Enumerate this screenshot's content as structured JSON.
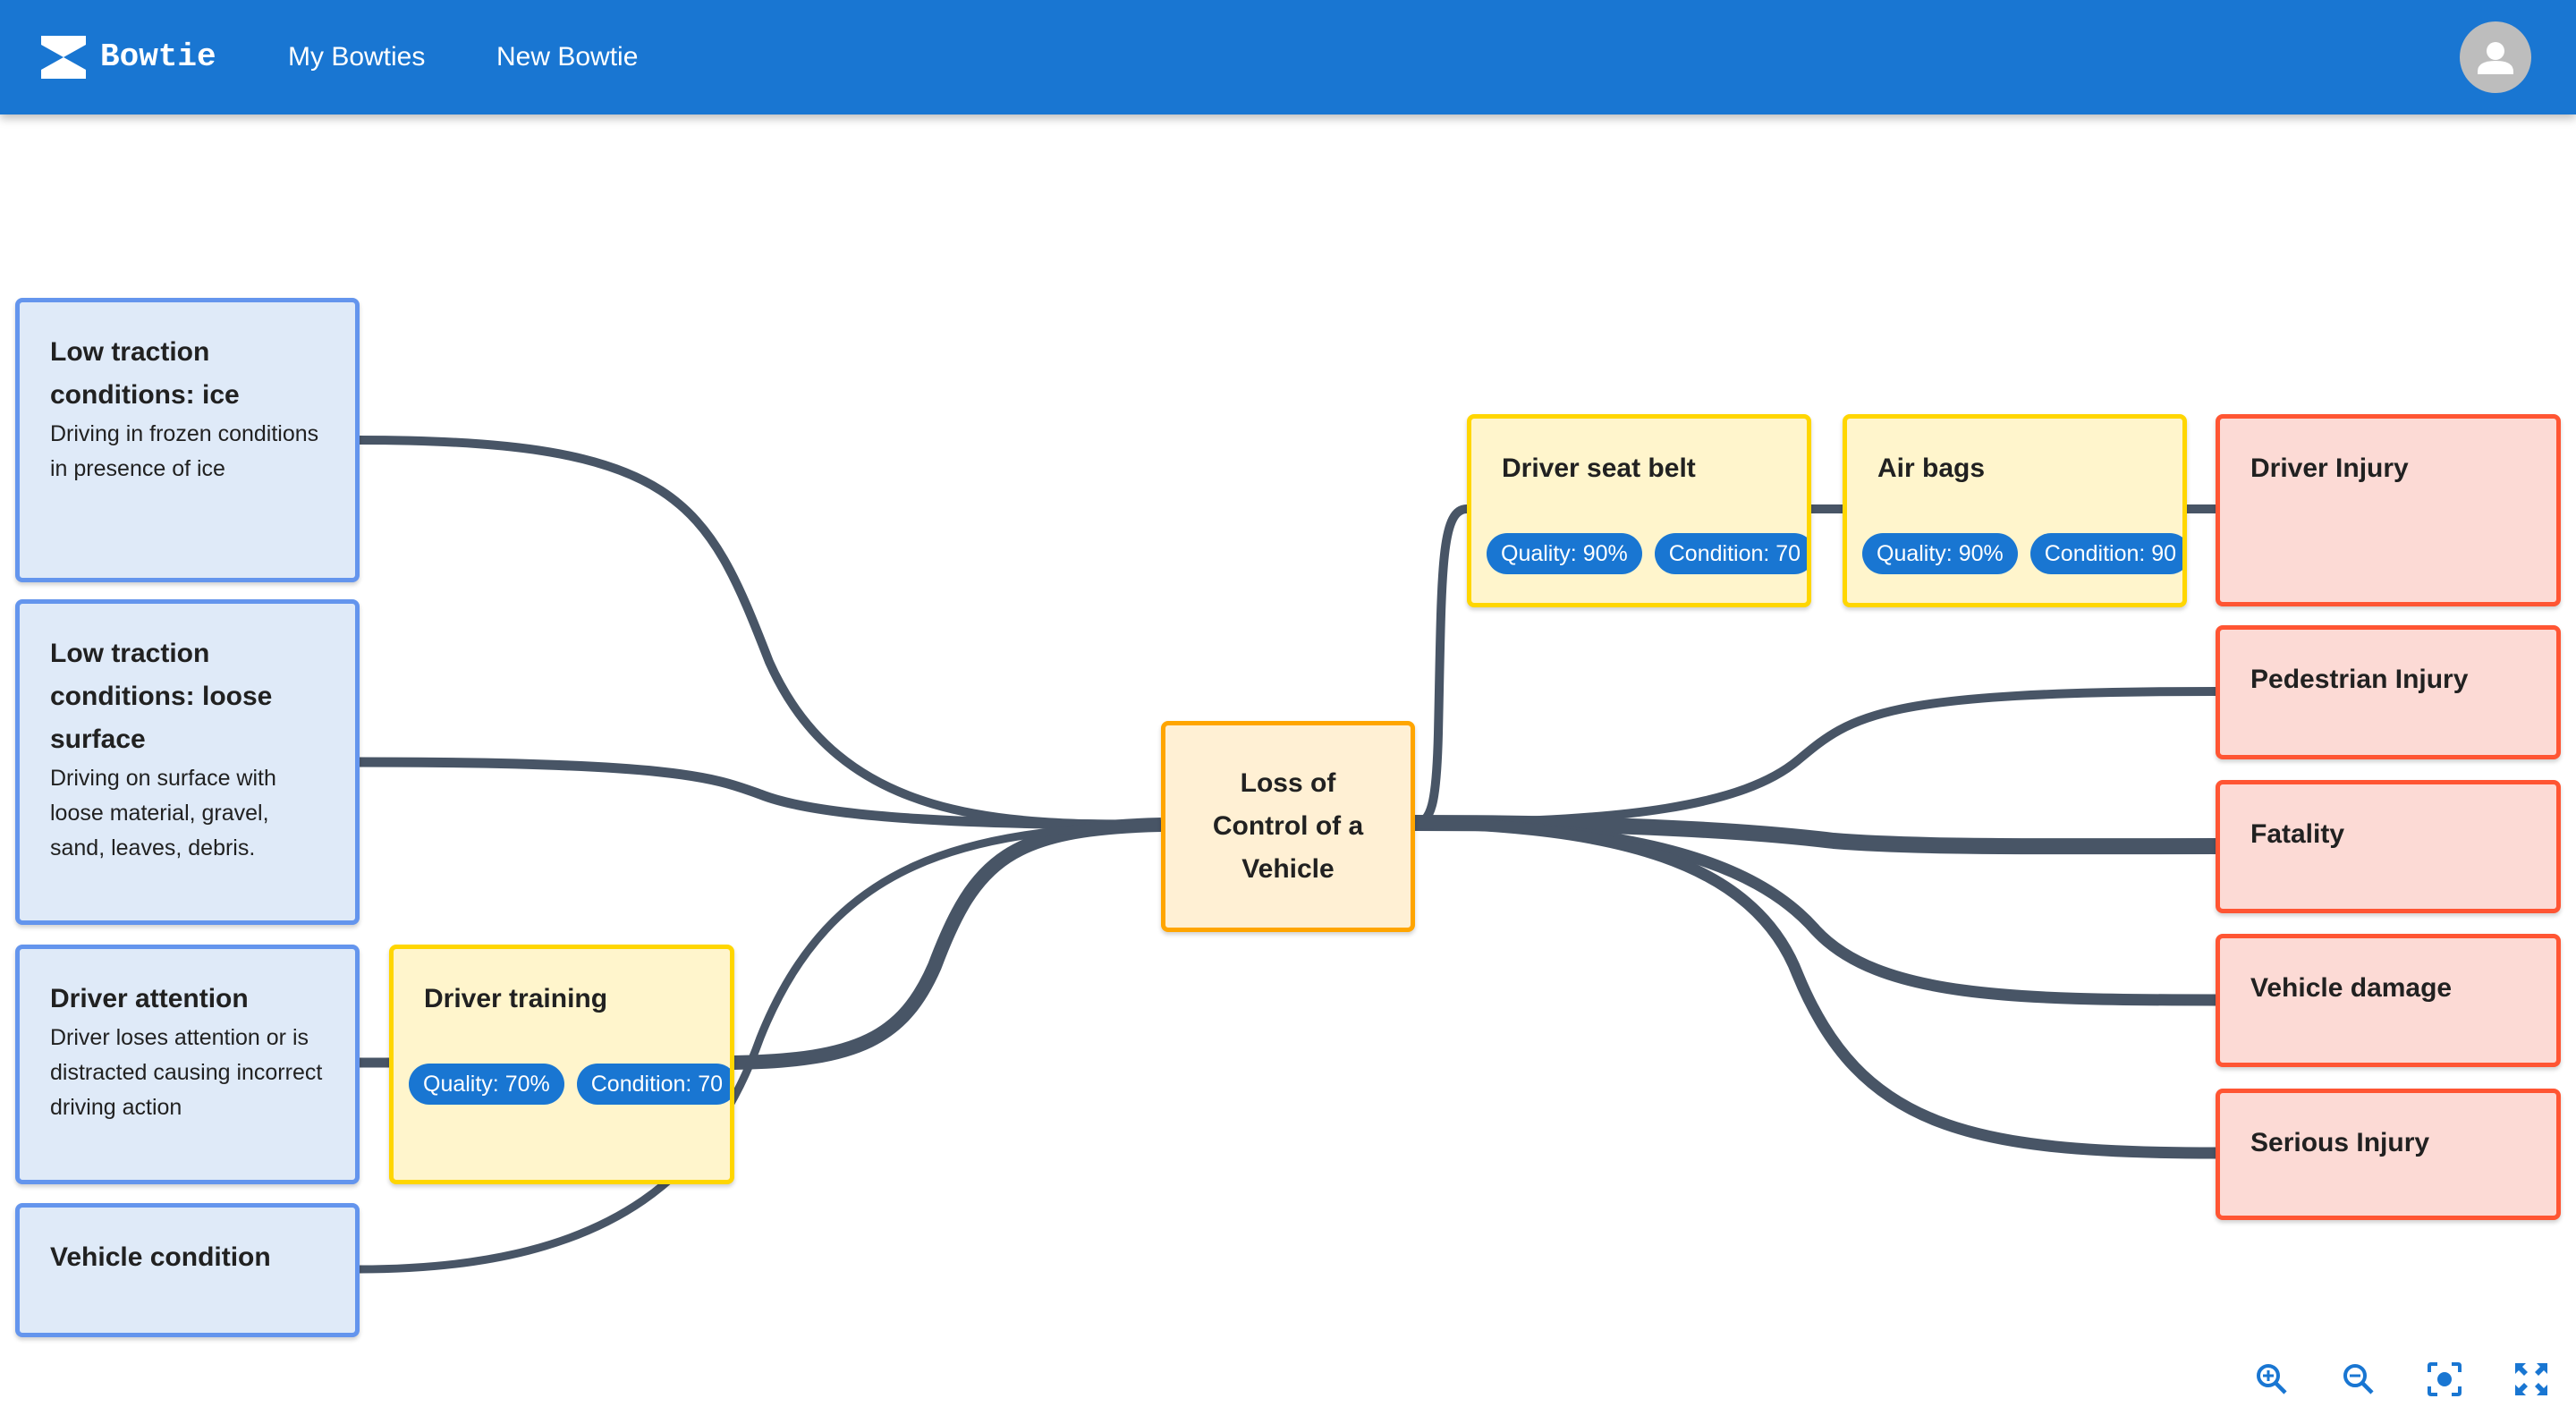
{
  "appbar": {
    "brand": "Bowtie",
    "nav": [
      "My Bowties",
      "New Bowtie"
    ],
    "logo_icon": "bowtie-logo-icon",
    "avatar_icon": "account-icon",
    "color": "#1976d2"
  },
  "diagram": {
    "causes": [
      {
        "title": "Low traction conditions: ice",
        "description": "Driving in frozen conditions in presence of ice"
      },
      {
        "title": "Low traction conditions: loose surface",
        "description": "Driving on surface with loose material, gravel, sand, leaves, debris."
      },
      {
        "title": "Driver attention",
        "description": "Driver loses attention or is distracted causing incorrect driving action"
      },
      {
        "title": "Vehicle condition",
        "description": ""
      }
    ],
    "preventive_barriers": [
      {
        "title": "Driver training",
        "quality": "Quality: 70%",
        "condition": "Condition: 70",
        "cause": "Driver attention"
      }
    ],
    "top_event": {
      "title": "Loss of Control of a Vehicle"
    },
    "mitigating_barriers": [
      {
        "title": "Driver seat belt",
        "quality": "Quality: 90%",
        "condition": "Condition: 70",
        "consequence": "Driver Injury"
      },
      {
        "title": "Air bags",
        "quality": "Quality: 90%",
        "condition": "Condition: 90",
        "consequence": "Driver Injury"
      }
    ],
    "consequences": [
      {
        "title": "Driver Injury"
      },
      {
        "title": "Pedestrian Injury"
      },
      {
        "title": "Fatality"
      },
      {
        "title": "Vehicle damage"
      },
      {
        "title": "Serious Injury"
      }
    ],
    "colors": {
      "cause_fill": "#dfeaf8",
      "cause_border": "#6495ed",
      "barrier_fill": "#fff5cc",
      "barrier_border": "#ffd600",
      "event_fill": "#fff0d4",
      "event_border": "#ffa500",
      "consequence_fill": "#fcdad5",
      "consequence_border": "#ff5533",
      "link": "#485566",
      "badge": "#1976d2"
    }
  },
  "controls": [
    {
      "name": "zoom-in",
      "icon": "zoom-in-icon"
    },
    {
      "name": "zoom-out",
      "icon": "zoom-out-icon"
    },
    {
      "name": "center-focus",
      "icon": "center-focus-icon"
    },
    {
      "name": "fullscreen",
      "icon": "fullscreen-icon"
    }
  ]
}
